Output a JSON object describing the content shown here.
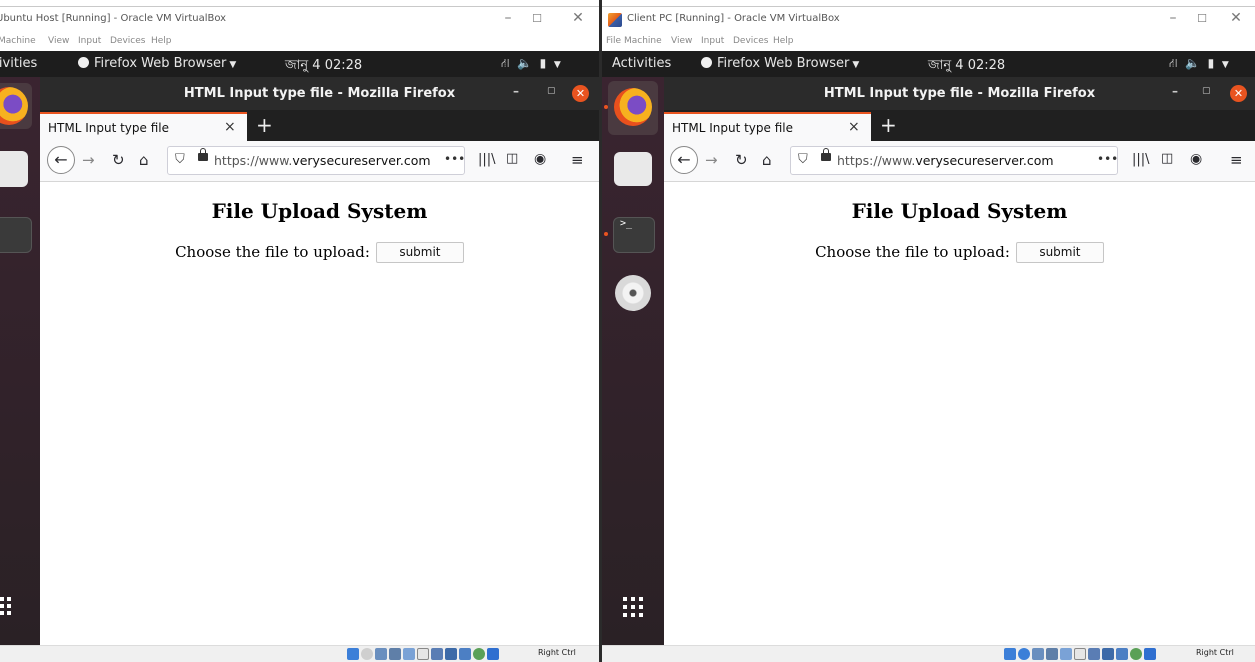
{
  "left": {
    "vbox_title": "Ubuntu Host [Running] - Oracle VM VirtualBox",
    "menu": [
      "Machine",
      "View",
      "Input",
      "Devices",
      "Help"
    ],
    "activities": "Activities",
    "app_menu": "Firefox Web Browser",
    "clock": "জানু 4  02:28",
    "ff_title": "HTML Input type file - Mozilla Firefox",
    "tab_label": "HTML Input type file",
    "url_prefix": "https://www.",
    "url_domain": "verysecureserver.com",
    "url_more": "•••",
    "page_title": "File Upload System",
    "form_label": "Choose the file to upload:",
    "submit_label": "submit",
    "host_key": "Right Ctrl"
  },
  "right": {
    "vbox_title": "Client PC [Running] - Oracle VM VirtualBox",
    "menu": [
      "File",
      "Machine",
      "View",
      "Input",
      "Devices",
      "Help"
    ],
    "activities": "Activities",
    "app_menu": "Firefox Web Browser",
    "clock": "জানু 4  02:28",
    "ff_title": "HTML Input type file - Mozilla Firefox",
    "tab_label": "HTML Input type file",
    "url_prefix": "https://www.",
    "url_domain": "verysecureserver.com",
    "url_more": "•••",
    "page_title": "File Upload System",
    "form_label": "Choose the file to upload:",
    "submit_label": "submit",
    "host_key": "Right Ctrl"
  },
  "colors": {
    "ubuntu_orange": "#e95420",
    "gnome_bar": "#1d1d1d",
    "firefox_header": "#2b2b2b"
  }
}
